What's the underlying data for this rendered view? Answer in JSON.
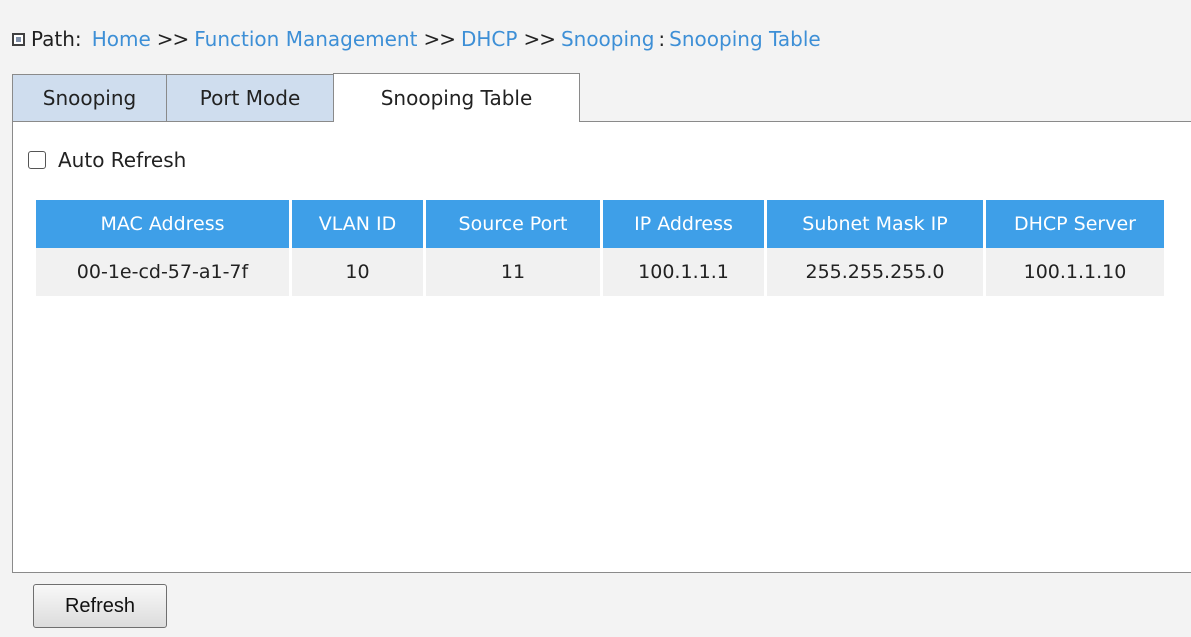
{
  "path": {
    "label": "Path:",
    "crumbs": [
      "Home",
      "Function Management",
      "DHCP",
      "Snooping"
    ],
    "separator": ">>",
    "colon": ":",
    "current": "Snooping Table"
  },
  "tabs": [
    {
      "label": "Snooping",
      "active": false
    },
    {
      "label": "Port Mode",
      "active": false
    },
    {
      "label": "Snooping Table",
      "active": true
    }
  ],
  "auto_refresh": {
    "label": "Auto Refresh",
    "checked": false
  },
  "table": {
    "headers": [
      "MAC Address",
      "VLAN ID",
      "Source Port",
      "IP Address",
      "Subnet Mask IP",
      "DHCP Server"
    ],
    "rows": [
      [
        "00-1e-cd-57-a1-7f",
        "10",
        "11",
        "100.1.1.1",
        "255.255.255.0",
        "100.1.1.10"
      ]
    ]
  },
  "buttons": {
    "refresh": "Refresh"
  },
  "colors": {
    "link": "#3d8fd6",
    "header_bg": "#3e9fe8",
    "tab_inactive_bg": "#cfddee",
    "row_bg": "#f1f1f1"
  }
}
